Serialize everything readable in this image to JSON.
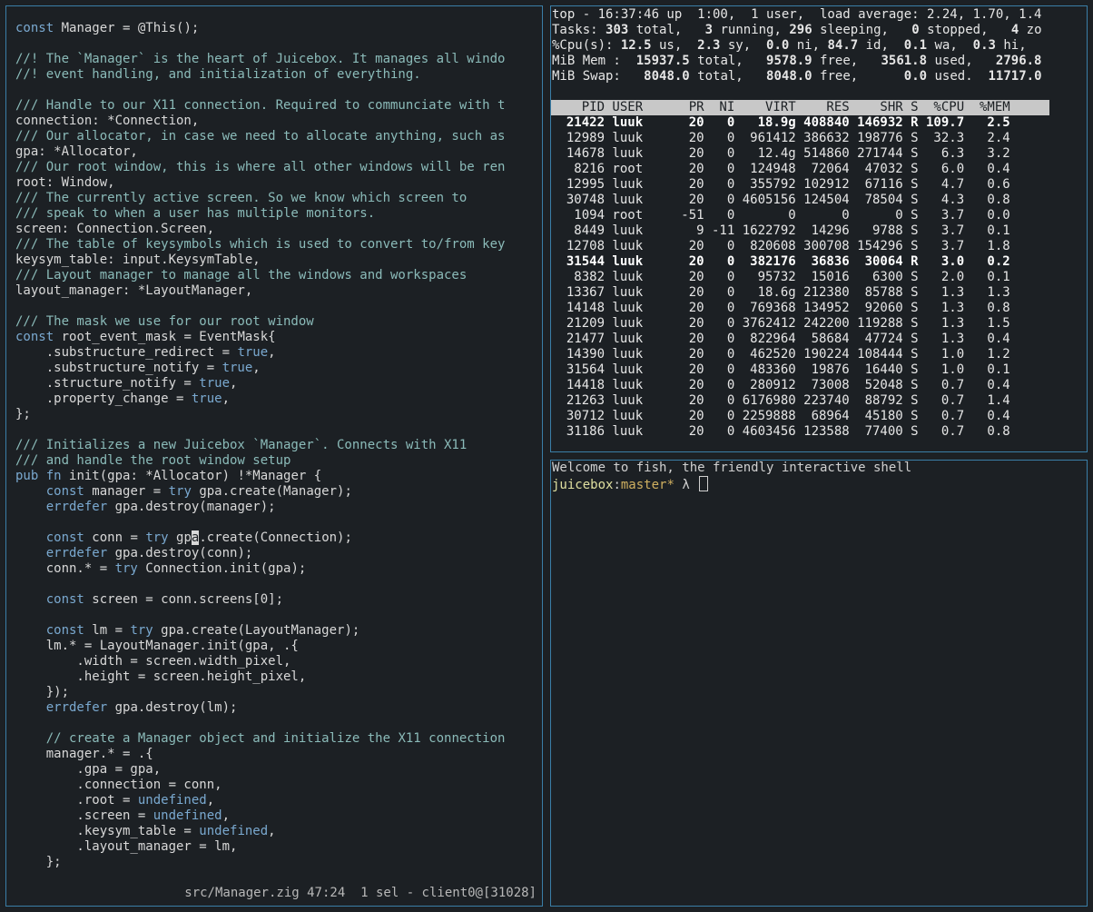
{
  "editor": {
    "lines": [
      [
        {
          "t": "const",
          "c": "kw"
        },
        {
          "t": " Manager = @This();",
          "c": "tx"
        }
      ],
      [],
      [
        {
          "t": "//! The `Manager` is the heart of Juicebox. It manages all windo",
          "c": "cm"
        }
      ],
      [
        {
          "t": "//! event handling, and initialization of everything.",
          "c": "cm"
        }
      ],
      [],
      [
        {
          "t": "/// Handle to our X11 connection. Required to communciate with t",
          "c": "cm"
        }
      ],
      [
        {
          "t": "connection: *Connection,",
          "c": "tx"
        }
      ],
      [
        {
          "t": "/// Our allocator, in case we need to allocate anything, such as",
          "c": "cm"
        }
      ],
      [
        {
          "t": "gpa: *Allocator,",
          "c": "tx"
        }
      ],
      [
        {
          "t": "/// Our root window, this is where all other windows will be ren",
          "c": "cm"
        }
      ],
      [
        {
          "t": "root: Window,",
          "c": "tx"
        }
      ],
      [
        {
          "t": "/// The currently active screen. So we know which screen to",
          "c": "cm"
        }
      ],
      [
        {
          "t": "/// speak to when a user has multiple monitors.",
          "c": "cm"
        }
      ],
      [
        {
          "t": "screen: Connection.Screen,",
          "c": "tx"
        }
      ],
      [
        {
          "t": "/// The table of keysymbols which is used to convert to/from key",
          "c": "cm"
        }
      ],
      [
        {
          "t": "keysym_table: input.KeysymTable,",
          "c": "tx"
        }
      ],
      [
        {
          "t": "/// Layout manager to manage all the windows and workspaces",
          "c": "cm"
        }
      ],
      [
        {
          "t": "layout_manager: *LayoutManager,",
          "c": "tx"
        }
      ],
      [],
      [
        {
          "t": "/// The mask we use for our root window",
          "c": "cm"
        }
      ],
      [
        {
          "t": "const",
          "c": "kw"
        },
        {
          "t": " root_event_mask = EventMask{",
          "c": "tx"
        }
      ],
      [
        {
          "t": "    .substructure_redirect = ",
          "c": "tx"
        },
        {
          "t": "true",
          "c": "lit"
        },
        {
          "t": ",",
          "c": "tx"
        }
      ],
      [
        {
          "t": "    .substructure_notify = ",
          "c": "tx"
        },
        {
          "t": "true",
          "c": "lit"
        },
        {
          "t": ",",
          "c": "tx"
        }
      ],
      [
        {
          "t": "    .structure_notify = ",
          "c": "tx"
        },
        {
          "t": "true",
          "c": "lit"
        },
        {
          "t": ",",
          "c": "tx"
        }
      ],
      [
        {
          "t": "    .property_change = ",
          "c": "tx"
        },
        {
          "t": "true",
          "c": "lit"
        },
        {
          "t": ",",
          "c": "tx"
        }
      ],
      [
        {
          "t": "};",
          "c": "tx"
        }
      ],
      [],
      [
        {
          "t": "/// Initializes a new Juicebox `Manager`. Connects with X11",
          "c": "cm"
        }
      ],
      [
        {
          "t": "/// and handle the root window setup",
          "c": "cm"
        }
      ],
      [
        {
          "t": "pub",
          "c": "kw"
        },
        {
          "t": " ",
          "c": "tx"
        },
        {
          "t": "fn",
          "c": "kw"
        },
        {
          "t": " init(gpa: *Allocator) !*Manager {",
          "c": "tx"
        }
      ],
      [
        {
          "t": "    ",
          "c": "tx"
        },
        {
          "t": "const",
          "c": "kw"
        },
        {
          "t": " manager = ",
          "c": "tx"
        },
        {
          "t": "try",
          "c": "kw"
        },
        {
          "t": " gpa.create(Manager);",
          "c": "tx"
        }
      ],
      [
        {
          "t": "    ",
          "c": "tx"
        },
        {
          "t": "errdefer",
          "c": "kw"
        },
        {
          "t": " gpa.destroy(manager);",
          "c": "tx"
        }
      ],
      [],
      [
        {
          "t": "    ",
          "c": "tx"
        },
        {
          "t": "const",
          "c": "kw"
        },
        {
          "t": " conn = ",
          "c": "tx"
        },
        {
          "t": "try",
          "c": "kw"
        },
        {
          "t": " gp",
          "c": "tx"
        },
        {
          "t": "a",
          "c": "cursor"
        },
        {
          "t": ".create(Connection);",
          "c": "tx"
        }
      ],
      [
        {
          "t": "    ",
          "c": "tx"
        },
        {
          "t": "errdefer",
          "c": "kw"
        },
        {
          "t": " gpa.destroy(conn);",
          "c": "tx"
        }
      ],
      [
        {
          "t": "    conn.* = ",
          "c": "tx"
        },
        {
          "t": "try",
          "c": "kw"
        },
        {
          "t": " Connection.init(gpa);",
          "c": "tx"
        }
      ],
      [],
      [
        {
          "t": "    ",
          "c": "tx"
        },
        {
          "t": "const",
          "c": "kw"
        },
        {
          "t": " screen = conn.screens[0];",
          "c": "tx"
        }
      ],
      [],
      [
        {
          "t": "    ",
          "c": "tx"
        },
        {
          "t": "const",
          "c": "kw"
        },
        {
          "t": " lm = ",
          "c": "tx"
        },
        {
          "t": "try",
          "c": "kw"
        },
        {
          "t": " gpa.create(LayoutManager);",
          "c": "tx"
        }
      ],
      [
        {
          "t": "    lm.* = LayoutManager.init(gpa, .{",
          "c": "tx"
        }
      ],
      [
        {
          "t": "        .width = screen.width_pixel,",
          "c": "tx"
        }
      ],
      [
        {
          "t": "        .height = screen.height_pixel,",
          "c": "tx"
        }
      ],
      [
        {
          "t": "    });",
          "c": "tx"
        }
      ],
      [
        {
          "t": "    ",
          "c": "tx"
        },
        {
          "t": "errdefer",
          "c": "kw"
        },
        {
          "t": " gpa.destroy(lm);",
          "c": "tx"
        }
      ],
      [],
      [
        {
          "t": "    ",
          "c": "tx"
        },
        {
          "t": "// create a Manager object and initialize the X11 connection",
          "c": "cm"
        }
      ],
      [
        {
          "t": "    manager.* = .{",
          "c": "tx"
        }
      ],
      [
        {
          "t": "        .gpa = gpa,",
          "c": "tx"
        }
      ],
      [
        {
          "t": "        .connection = conn,",
          "c": "tx"
        }
      ],
      [
        {
          "t": "        .root = ",
          "c": "tx"
        },
        {
          "t": "undefined",
          "c": "lit"
        },
        {
          "t": ",",
          "c": "tx"
        }
      ],
      [
        {
          "t": "        .screen = ",
          "c": "tx"
        },
        {
          "t": "undefined",
          "c": "lit"
        },
        {
          "t": ",",
          "c": "tx"
        }
      ],
      [
        {
          "t": "        .keysym_table = ",
          "c": "tx"
        },
        {
          "t": "undefined",
          "c": "lit"
        },
        {
          "t": ",",
          "c": "tx"
        }
      ],
      [
        {
          "t": "        .layout_manager = lm,",
          "c": "tx"
        }
      ],
      [
        {
          "t": "    };",
          "c": "tx"
        }
      ]
    ],
    "modeline": "src/Manager.zig 47:24  1 sel - client0@[31028]"
  },
  "top": {
    "summary": [
      [
        {
          "t": "top - 16:37:46 up  1:00,  1 user,  load average: 2.24, 1.70, 1.4"
        }
      ],
      [
        {
          "t": "Tasks: "
        },
        {
          "t": "303",
          "b": true
        },
        {
          "t": " total,   "
        },
        {
          "t": "3",
          "b": true
        },
        {
          "t": " running, "
        },
        {
          "t": "296",
          "b": true
        },
        {
          "t": " sleeping,   "
        },
        {
          "t": "0",
          "b": true
        },
        {
          "t": " stopped,   "
        },
        {
          "t": "4",
          "b": true
        },
        {
          "t": " zo"
        }
      ],
      [
        {
          "t": "%Cpu(s): "
        },
        {
          "t": "12.5",
          "b": true
        },
        {
          "t": " us,  "
        },
        {
          "t": "2.3",
          "b": true
        },
        {
          "t": " sy,  "
        },
        {
          "t": "0.0",
          "b": true
        },
        {
          "t": " ni, "
        },
        {
          "t": "84.7",
          "b": true
        },
        {
          "t": " id,  "
        },
        {
          "t": "0.1",
          "b": true
        },
        {
          "t": " wa,  "
        },
        {
          "t": "0.3",
          "b": true
        },
        {
          "t": " hi,"
        }
      ],
      [
        {
          "t": "MiB Mem :  "
        },
        {
          "t": "15937.5",
          "b": true
        },
        {
          "t": " total,   "
        },
        {
          "t": "9578.9",
          "b": true
        },
        {
          "t": " free,   "
        },
        {
          "t": "3561.8",
          "b": true
        },
        {
          "t": " used,   "
        },
        {
          "t": "2796.8",
          "b": true
        }
      ],
      [
        {
          "t": "MiB Swap:   "
        },
        {
          "t": "8048.0",
          "b": true
        },
        {
          "t": " total,   "
        },
        {
          "t": "8048.0",
          "b": true
        },
        {
          "t": " free,      "
        },
        {
          "t": "0.0",
          "b": true
        },
        {
          "t": " used.  "
        },
        {
          "t": "11717.0",
          "b": true
        }
      ]
    ],
    "header": "    PID USER      PR  NI    VIRT    RES    SHR S  %CPU  %MEM",
    "rows": [
      {
        "text": "  21422 luuk      20   0   18.9g 408840 146932 R 109.7   2.5",
        "running": true
      },
      {
        "text": "  12989 luuk      20   0  961412 386632 198776 S  32.3   2.4",
        "running": false
      },
      {
        "text": "  14678 luuk      20   0   12.4g 514860 271744 S   6.3   3.2",
        "running": false
      },
      {
        "text": "   8216 root      20   0  124948  72064  47032 S   6.0   0.4",
        "running": false
      },
      {
        "text": "  12995 luuk      20   0  355792 102912  67116 S   4.7   0.6",
        "running": false
      },
      {
        "text": "  30748 luuk      20   0 4605156 124504  78504 S   4.3   0.8",
        "running": false
      },
      {
        "text": "   1094 root     -51   0       0      0      0 S   3.7   0.0",
        "running": false
      },
      {
        "text": "   8449 luuk       9 -11 1622792  14296   9788 S   3.7   0.1",
        "running": false
      },
      {
        "text": "  12708 luuk      20   0  820608 300708 154296 S   3.7   1.8",
        "running": false
      },
      {
        "text": "  31544 luuk      20   0  382176  36836  30064 R   3.0   0.2",
        "running": true
      },
      {
        "text": "   8382 luuk      20   0   95732  15016   6300 S   2.0   0.1",
        "running": false
      },
      {
        "text": "  13367 luuk      20   0   18.6g 212380  85788 S   1.3   1.3",
        "running": false
      },
      {
        "text": "  14148 luuk      20   0  769368 134952  92060 S   1.3   0.8",
        "running": false
      },
      {
        "text": "  21209 luuk      20   0 3762412 242200 119288 S   1.3   1.5",
        "running": false
      },
      {
        "text": "  21477 luuk      20   0  822964  58684  47724 S   1.3   0.4",
        "running": false
      },
      {
        "text": "  14390 luuk      20   0  462520 190224 108444 S   1.0   1.2",
        "running": false
      },
      {
        "text": "  31564 luuk      20   0  483360  19876  16440 S   1.0   0.1",
        "running": false
      },
      {
        "text": "  14418 luuk      20   0  280912  73008  52048 S   0.7   0.4",
        "running": false
      },
      {
        "text": "  21263 luuk      20   0 6176980 223740  88792 S   0.7   1.4",
        "running": false
      },
      {
        "text": "  30712 luuk      20   0 2259888  68964  45180 S   0.7   0.4",
        "running": false
      },
      {
        "text": "  31186 luuk      20   0 4603456 123588  77400 S   0.7   0.8",
        "running": false
      }
    ]
  },
  "shell": {
    "welcome": "Welcome to fish, the friendly interactive shell",
    "prompt_host": "juicebox",
    "prompt_sep": ":",
    "prompt_branch": "master*",
    "prompt_symbol": " λ "
  },
  "colors": {
    "background": "#1c2024",
    "pane_border": "#3a7ea7",
    "keyword": "#7aa9d0",
    "comment": "#8bbbb9",
    "prompt_host": "#e0e0a0",
    "prompt_branch": "#d0b060"
  }
}
